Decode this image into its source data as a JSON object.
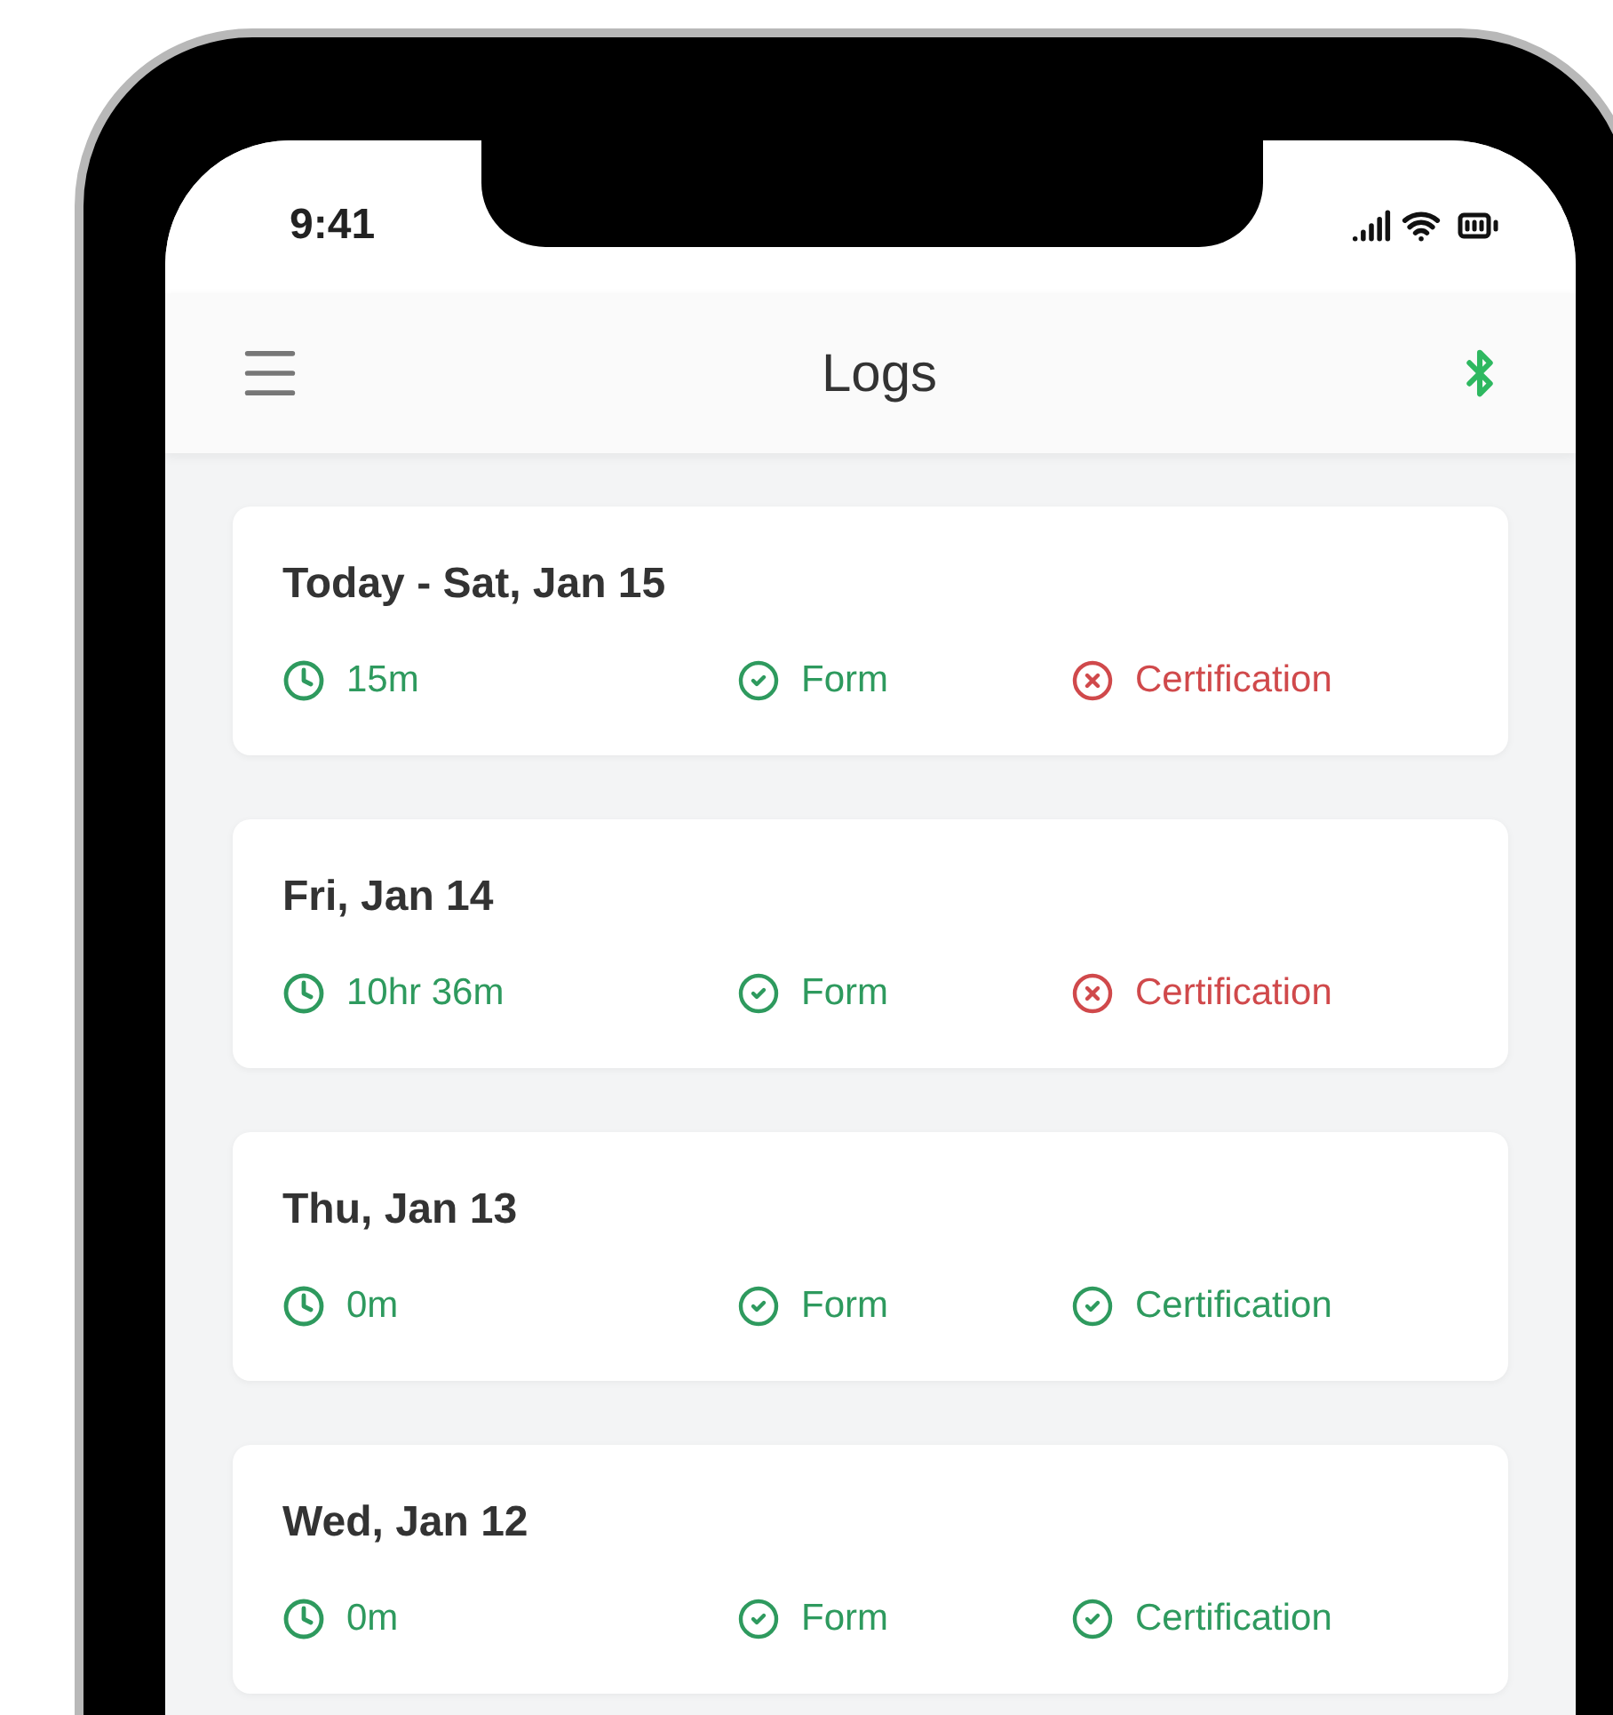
{
  "status_bar": {
    "time": "9:41"
  },
  "header": {
    "title": "Logs"
  },
  "logs": [
    {
      "date": "Today - Sat, Jan 15",
      "duration": "15m",
      "form": {
        "label": "Form",
        "passed": true
      },
      "certification": {
        "label": "Certification",
        "passed": false
      }
    },
    {
      "date": "Fri, Jan 14",
      "duration": "10hr 36m",
      "form": {
        "label": "Form",
        "passed": true
      },
      "certification": {
        "label": "Certification",
        "passed": false
      }
    },
    {
      "date": "Thu, Jan 13",
      "duration": "0m",
      "form": {
        "label": "Form",
        "passed": true
      },
      "certification": {
        "label": "Certification",
        "passed": true
      }
    },
    {
      "date": "Wed, Jan 12",
      "duration": "0m",
      "form": {
        "label": "Form",
        "passed": true
      },
      "certification": {
        "label": "Certification",
        "passed": true
      }
    }
  ]
}
